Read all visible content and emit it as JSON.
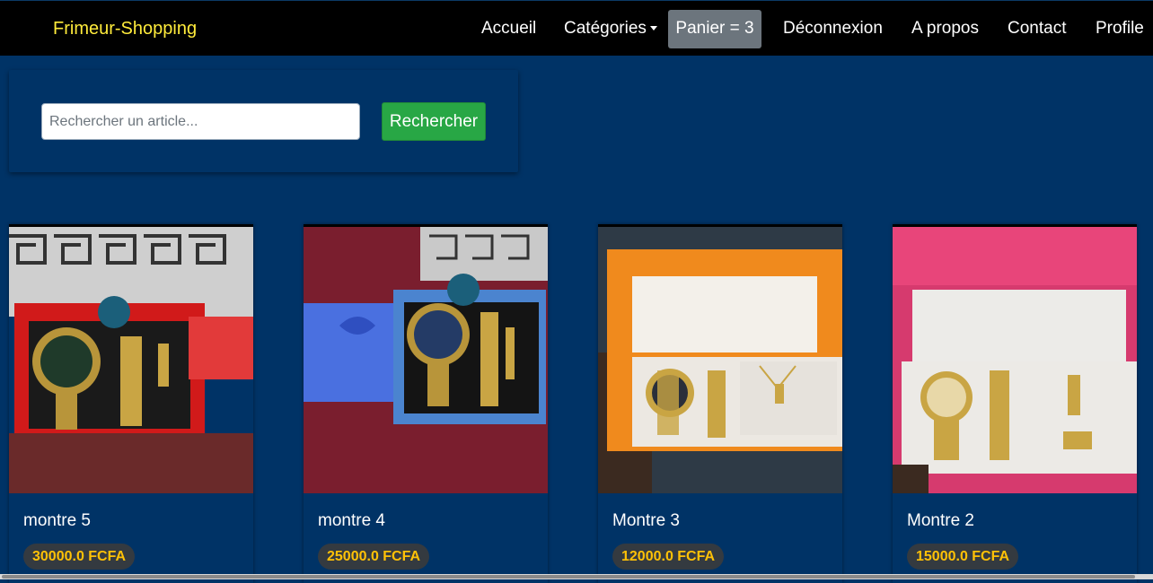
{
  "navbar": {
    "brand": "Frimeur-Shopping",
    "links": {
      "home": "Accueil",
      "categories": "Catégories",
      "cart": "Panier = 3",
      "logout": "Déconnexion",
      "about": "A propos",
      "contact": "Contact",
      "profile": "Profile"
    }
  },
  "search": {
    "placeholder": "Rechercher un article...",
    "button": "Rechercher"
  },
  "products": [
    {
      "name": "montre 5",
      "price": "30000.0 FCFA"
    },
    {
      "name": "montre 4",
      "price": "25000.0 FCFA"
    },
    {
      "name": "Montre 3",
      "price": "12000.0 FCFA"
    },
    {
      "name": "Montre 2",
      "price": "15000.0 FCFA"
    }
  ],
  "colors": {
    "page_bg": "#003366",
    "navbar_bg": "#000000",
    "brand": "#ffeb3b",
    "search_button": "#28a745",
    "price_text": "#ffc107",
    "price_bg": "#343a40"
  }
}
